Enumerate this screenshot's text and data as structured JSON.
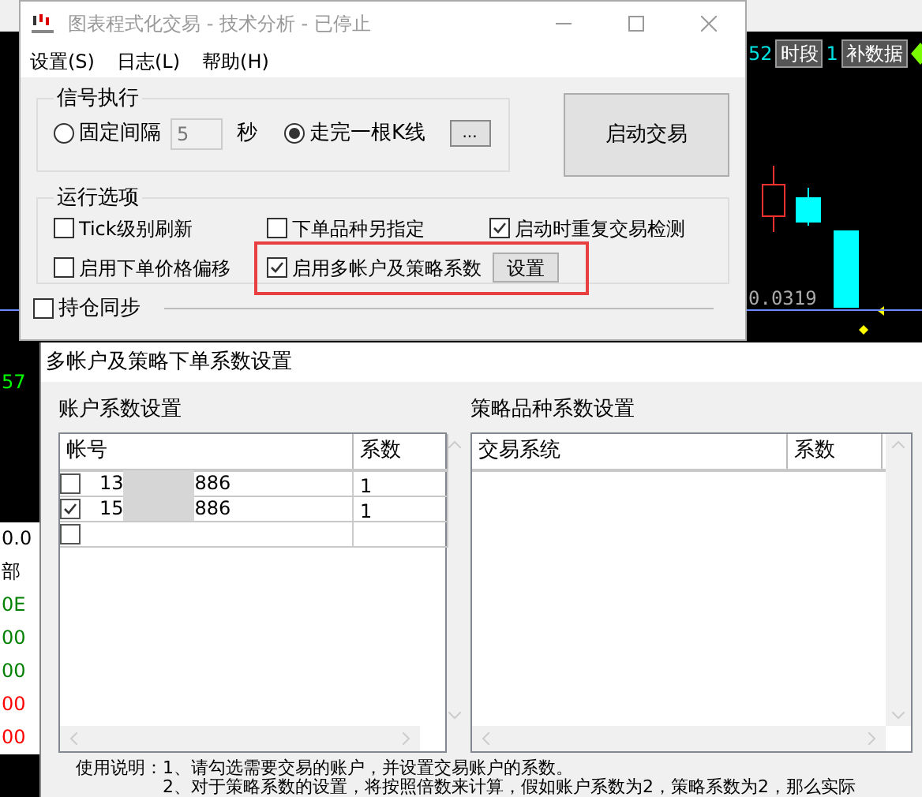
{
  "background_chart": {
    "toolbar": [
      {
        "kind": "text",
        "label": "52"
      },
      {
        "kind": "button",
        "label": "时段"
      },
      {
        "kind": "text",
        "label": "1"
      },
      {
        "kind": "button",
        "label": "补数据"
      }
    ],
    "price_label": "0.0319",
    "left_labels": [
      {
        "label": "57",
        "color": "#00ff00"
      },
      {
        "label": "0.0",
        "color": "#000000"
      },
      {
        "label": "部",
        "color": "#000000"
      },
      {
        "label": "0E",
        "color": "#008000"
      },
      {
        "label": "00",
        "color": "#008000"
      },
      {
        "label": "00",
        "color": "#008000"
      },
      {
        "label": "00",
        "color": "#ff0000"
      },
      {
        "label": "00",
        "color": "#ff0000"
      }
    ]
  },
  "main_window": {
    "title": "图表程式化交易 - 技术分析 - 已停止",
    "menu": [
      "设置(S)",
      "日志(L)",
      "帮助(H)"
    ],
    "signal_group": {
      "title": "信号执行",
      "options": [
        {
          "label": "固定间隔",
          "selected": false
        },
        {
          "label": "走完一根K线",
          "selected": true
        }
      ],
      "interval_value": "5",
      "interval_unit": "秒",
      "more_button": "..."
    },
    "start_button": "启动交易",
    "run_options": {
      "title": "运行选项",
      "options": [
        {
          "label": "Tick级别刷新",
          "checked": false
        },
        {
          "label": "下单品种另指定",
          "checked": false
        },
        {
          "label": "启动时重复交易检测",
          "checked": true
        },
        {
          "label": "启用下单价格偏移",
          "checked": false
        },
        {
          "label": "启用多帐户及策略系数",
          "checked": true,
          "highlighted": true
        }
      ],
      "settings_button": "设置"
    },
    "position_sync": {
      "label": "持仓同步",
      "checked": false
    }
  },
  "dialog": {
    "title": "多帐户及策略下单系数设置",
    "account_panel": {
      "title": "账户系数设置",
      "columns": [
        "帐号",
        "系数"
      ],
      "rows": [
        {
          "checked": false,
          "account_start": "13",
          "account_end": "886",
          "coefficient": "1"
        },
        {
          "checked": true,
          "account_start": "15",
          "account_end": "886",
          "coefficient": "1"
        },
        {
          "checked": false
        }
      ]
    },
    "strategy_panel": {
      "title": "策略品种系数设置",
      "columns": [
        "交易系统",
        "系数"
      ]
    },
    "instructions": {
      "label": "使用说明：",
      "lines": [
        "1、请勾选需要交易的账户，并设置交易账户的系数。",
        "2、对于策略系数的设置，将按照倍数来计算，假如账户系数为2，策略系数为2，那么实际"
      ]
    }
  }
}
